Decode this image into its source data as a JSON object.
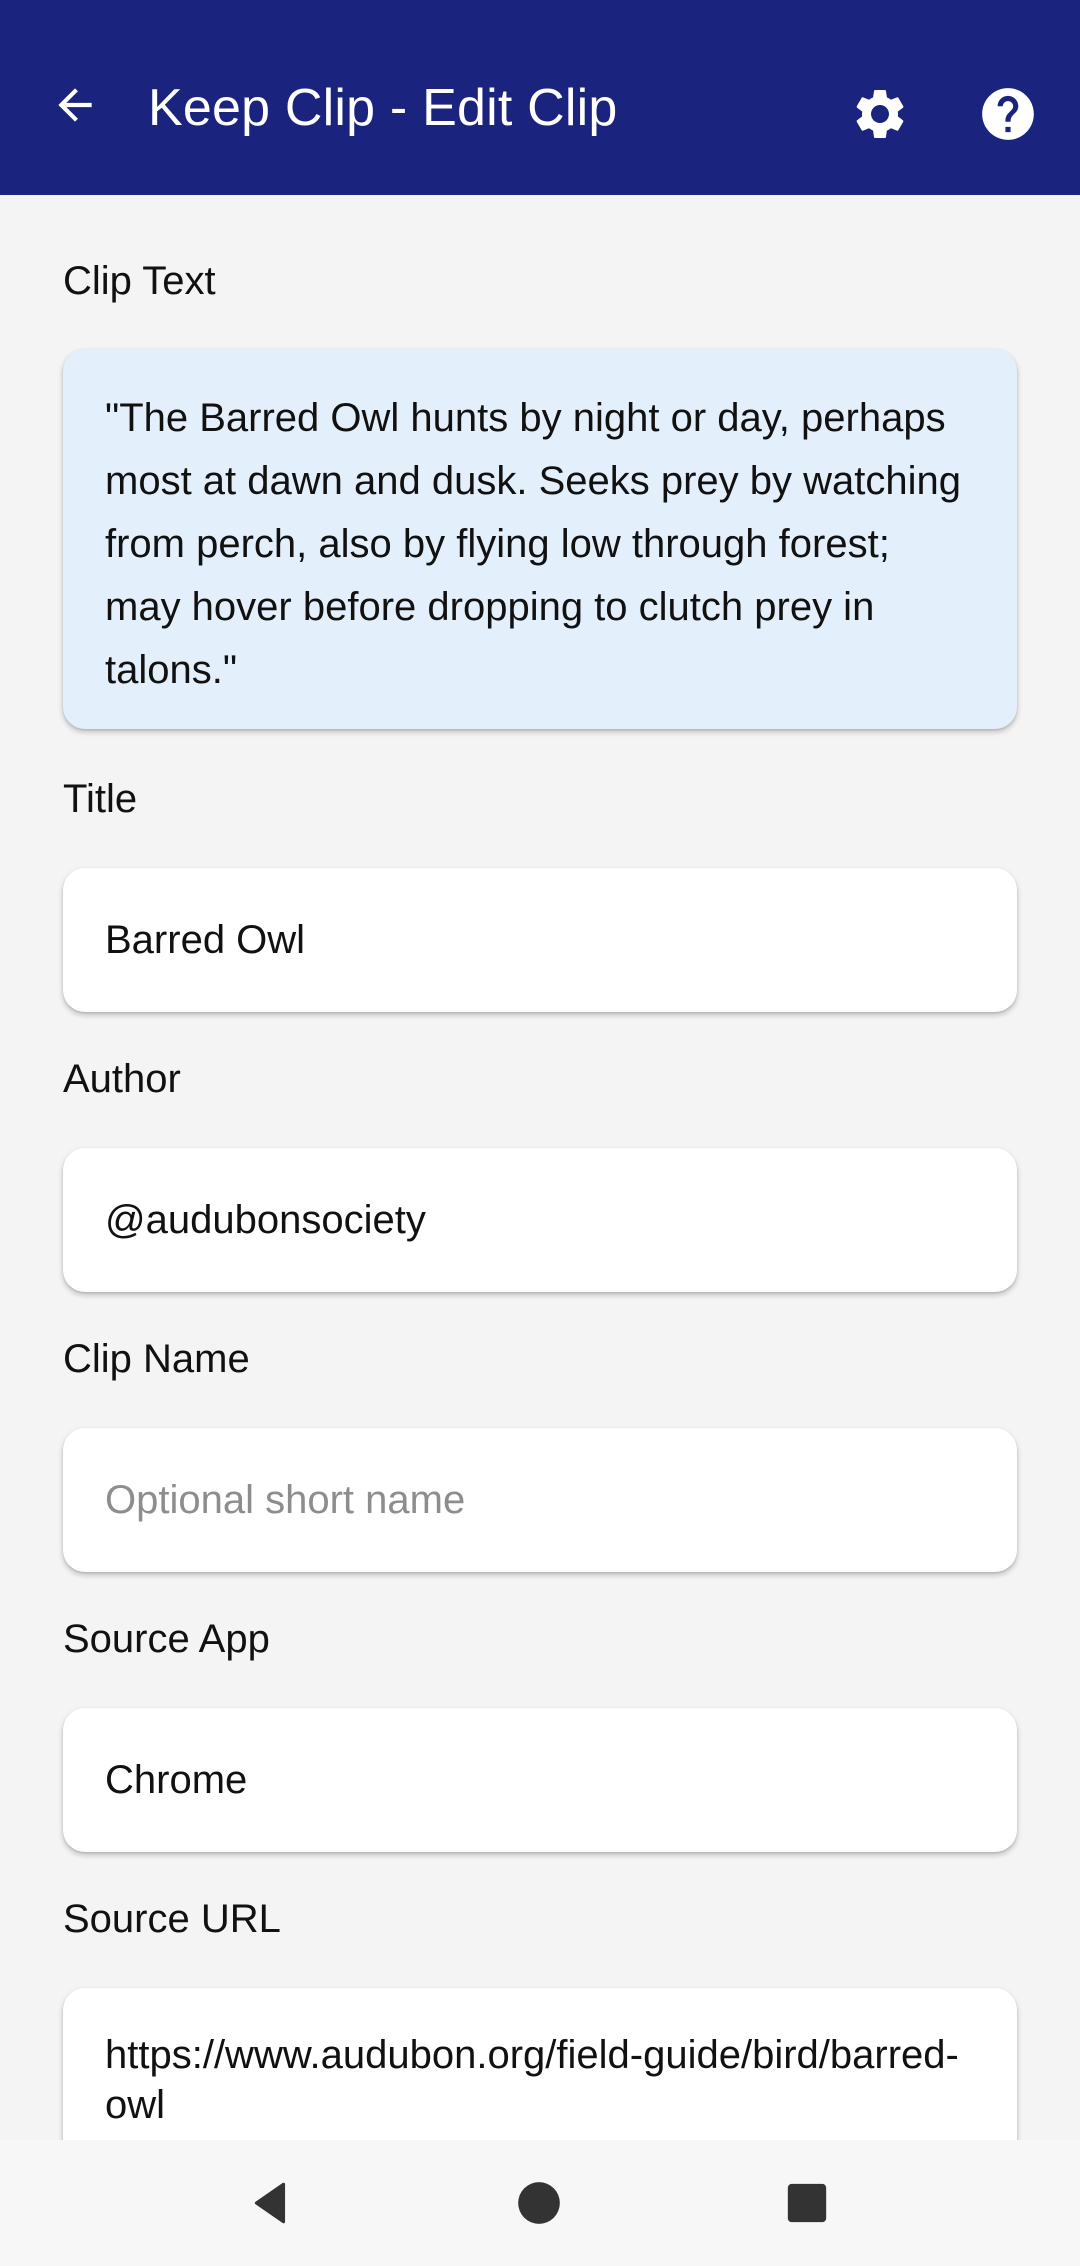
{
  "app_bar": {
    "title": "Keep Clip - Edit Clip",
    "back_icon": "arrow-left-icon",
    "settings_icon": "gear-icon",
    "help_icon": "help-circle-icon",
    "background_color": "#1a237e"
  },
  "form": {
    "clip_text": {
      "label": "Clip Text",
      "value": "\"The Barred Owl hunts by night or day, perhaps most at dawn and dusk. Seeks prey by watching from perch, also by flying low through forest; may hover before dropping to clutch prey in talons.\"",
      "background_color": "#e3f0fb"
    },
    "title": {
      "label": "Title",
      "value": "Barred Owl"
    },
    "author": {
      "label": "Author",
      "value": "@audubonsociety"
    },
    "clip_name": {
      "label": "Clip Name",
      "value": "",
      "placeholder": "Optional short name"
    },
    "source_app": {
      "label": "Source App",
      "value": "Chrome"
    },
    "source_url": {
      "label": "Source URL",
      "value": "https://www.audubon.org/field-guide/bird/barred-owl"
    }
  },
  "nav_bar": {
    "back_icon": "triangle-back-icon",
    "home_icon": "circle-home-icon",
    "recents_icon": "square-recents-icon"
  }
}
